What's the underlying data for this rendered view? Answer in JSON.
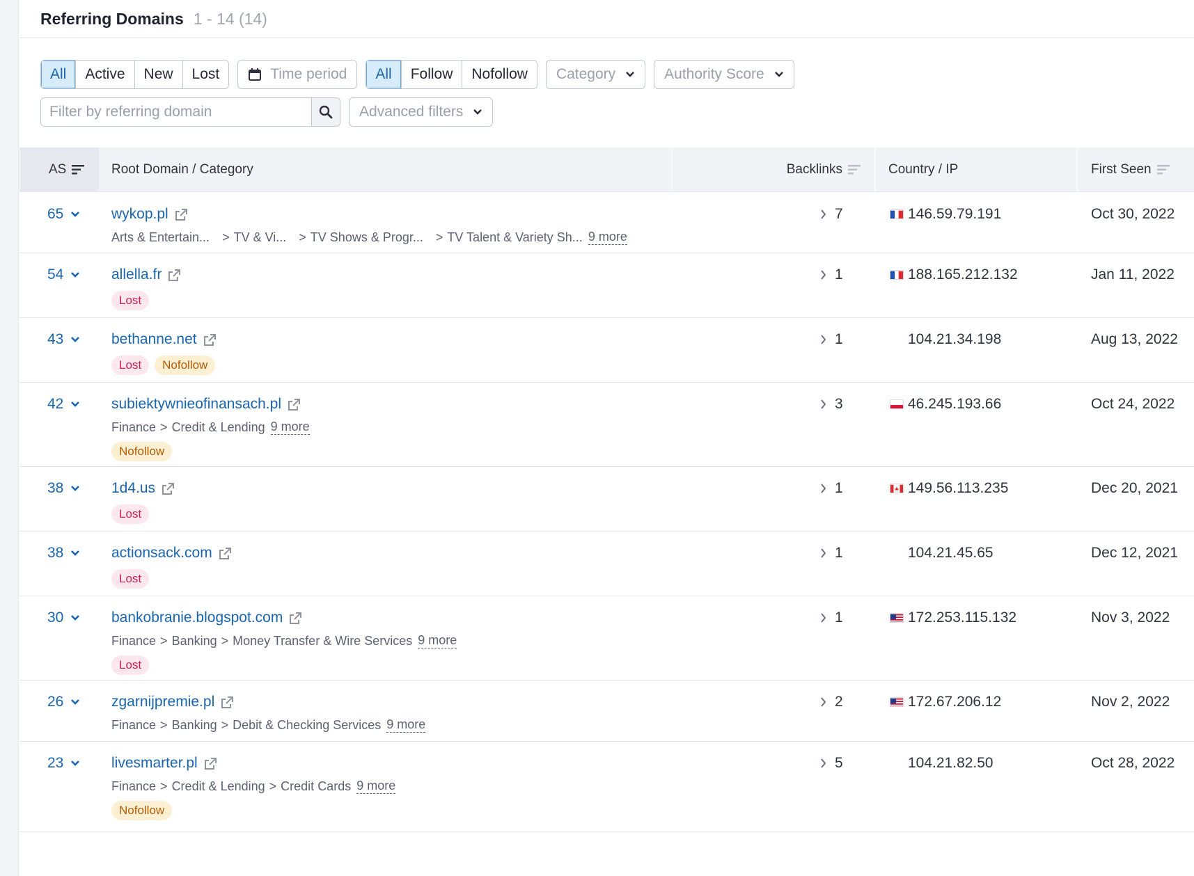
{
  "header": {
    "title": "Referring Domains",
    "count": "1 - 14 (14)"
  },
  "filters": {
    "status_options": [
      "All",
      "Active",
      "New",
      "Lost"
    ],
    "time_period": "Time period",
    "link_type_options": [
      "All",
      "Follow",
      "Nofollow"
    ],
    "category": "Category",
    "authority_score": "Authority Score",
    "search_placeholder": "Filter by referring domain",
    "advanced": "Advanced filters"
  },
  "table": {
    "columns": {
      "as": "AS",
      "root": "Root Domain / Category",
      "backlinks": "Backlinks",
      "country": "Country / IP",
      "first_seen": "First Seen"
    },
    "rows": [
      {
        "as": "65",
        "domain": "wykop.pl",
        "cats": [
          "Arts & Entertain...",
          "TV & Vi...",
          "TV Shows & Progr...",
          "TV Talent & Variety Sh..."
        ],
        "more": "9 more",
        "tags": [],
        "backlinks": "7",
        "flag": "fr",
        "ip": "146.59.79.191",
        "date": "Oct 30, 2022"
      },
      {
        "as": "54",
        "domain": "allella.fr",
        "cats": [],
        "more": "",
        "tags": [
          "Lost"
        ],
        "backlinks": "1",
        "flag": "fr",
        "ip": "188.165.212.132",
        "date": "Jan 11, 2022"
      },
      {
        "as": "43",
        "domain": "bethanne.net",
        "cats": [],
        "more": "",
        "tags": [
          "Lost",
          "Nofollow"
        ],
        "backlinks": "1",
        "flag": "none",
        "ip": "104.21.34.198",
        "date": "Aug 13, 2022"
      },
      {
        "as": "42",
        "domain": "subiektywnieofinansach.pl",
        "cats": [
          "Finance",
          "Credit & Lending"
        ],
        "more": "9 more",
        "tags": [
          "Nofollow"
        ],
        "backlinks": "3",
        "flag": "pl",
        "ip": "46.245.193.66",
        "date": "Oct 24, 2022"
      },
      {
        "as": "38",
        "domain": "1d4.us",
        "cats": [],
        "more": "",
        "tags": [
          "Lost"
        ],
        "backlinks": "1",
        "flag": "ca",
        "ip": "149.56.113.235",
        "date": "Dec 20, 2021"
      },
      {
        "as": "38",
        "domain": "actionsack.com",
        "cats": [],
        "more": "",
        "tags": [
          "Lost"
        ],
        "backlinks": "1",
        "flag": "none",
        "ip": "104.21.45.65",
        "date": "Dec 12, 2021"
      },
      {
        "as": "30",
        "domain": "bankobranie.blogspot.com",
        "cats": [
          "Finance",
          "Banking",
          "Money Transfer & Wire Services"
        ],
        "more": "9 more",
        "tags": [
          "Lost"
        ],
        "backlinks": "1",
        "flag": "us",
        "ip": "172.253.115.132",
        "date": "Nov 3, 2022"
      },
      {
        "as": "26",
        "domain": "zgarnijpremie.pl",
        "cats": [
          "Finance",
          "Banking",
          "Debit & Checking Services"
        ],
        "more": "9 more",
        "tags": [],
        "backlinks": "2",
        "flag": "us",
        "ip": "172.67.206.12",
        "date": "Nov 2, 2022"
      },
      {
        "as": "23",
        "domain": "livesmarter.pl",
        "cats": [
          "Finance",
          "Credit & Lending",
          "Credit Cards"
        ],
        "more": "9 more",
        "tags": [
          "Nofollow"
        ],
        "backlinks": "5",
        "flag": "none",
        "ip": "104.21.82.50",
        "date": "Oct 28, 2022"
      }
    ]
  },
  "colors": {
    "link": "#1a65b0",
    "lost_bg": "#fde7ee",
    "lost_text": "#d1204f",
    "nofollow_bg": "#fdefd2",
    "nofollow_text": "#b35a00",
    "active_filter_bg": "#d7ecfb"
  },
  "icons": {
    "as_sort": "sort-icon",
    "row_expand": "chevron-down-icon",
    "external": "external-link-icon",
    "backlinks_expand": "chevron-right-icon",
    "search": "search-icon",
    "calendar": "calendar-icon"
  }
}
